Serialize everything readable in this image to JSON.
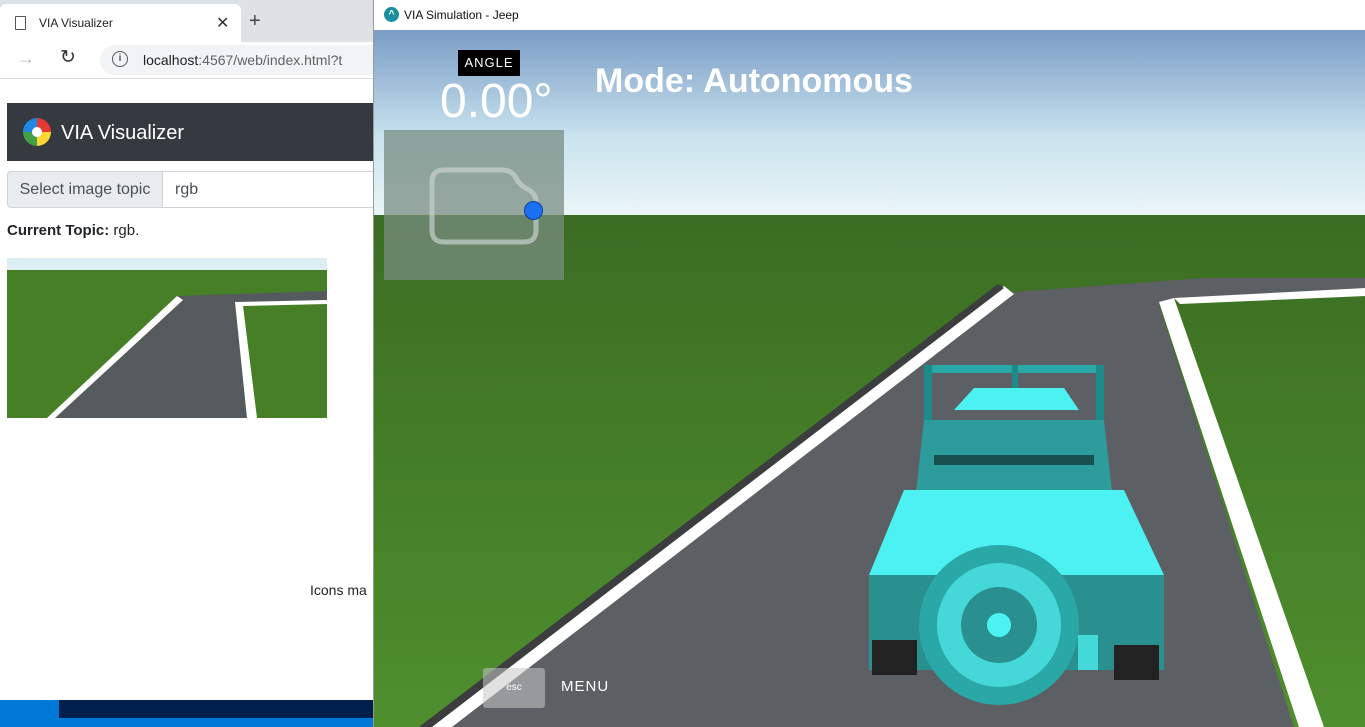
{
  "browser": {
    "tab_title": "VIA Visualizer",
    "new_tab_symbol": "+",
    "close_symbol": "✕",
    "url_host": "localhost",
    "url_rest": ":4567/web/index.html?t",
    "icons": {
      "back": "arrow-right-icon",
      "reload": "reload-icon",
      "info": "info-icon"
    }
  },
  "app": {
    "brand": "VIA Visualizer",
    "select_label": "Select image topic",
    "select_value": "rgb",
    "current_topic_label": "Current Topic:",
    "current_topic_value": "rgb.",
    "icons_made_text": "Icons ma"
  },
  "simulation": {
    "window_title": "VIA Simulation - Jeep",
    "angle_label": "ANGLE",
    "angle_value": "0.00°",
    "mode_text": "Mode: Autonomous",
    "esc_label": "esc",
    "menu_label": "MENU"
  },
  "colors": {
    "navbar": "#343a40",
    "jeep": "#2fb8b8",
    "grass": "#4b8a2a",
    "road": "#5c5f63",
    "minimap_dot": "#1a6ff2"
  }
}
